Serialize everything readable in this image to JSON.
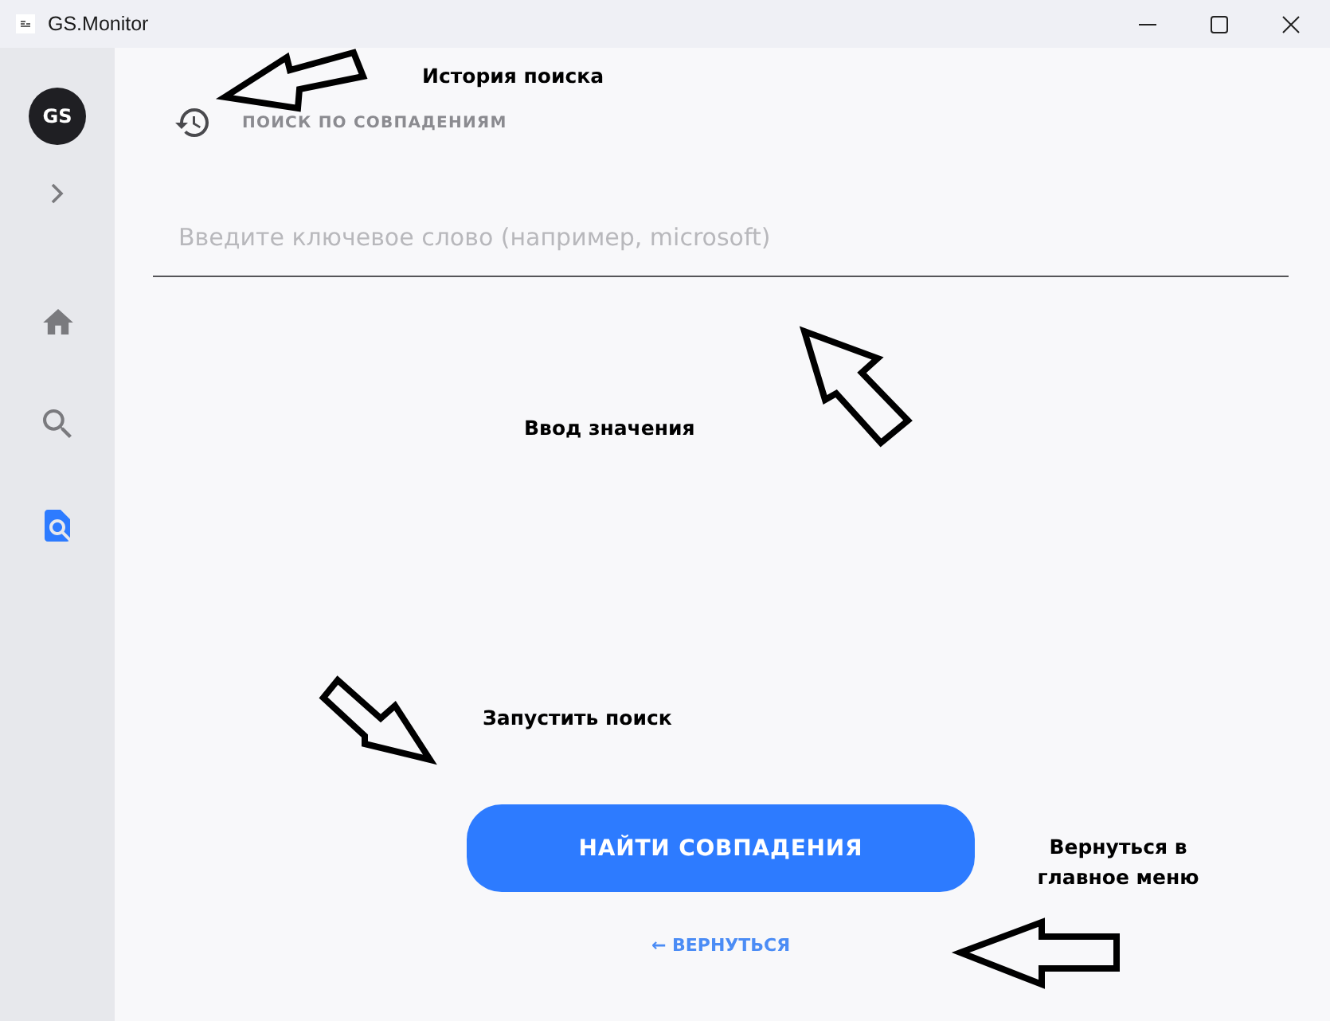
{
  "window": {
    "title": "GS.Monitor"
  },
  "sidebar": {
    "avatar": "GS",
    "expanded": false,
    "nav_items": [
      {
        "kind": "home",
        "selected": false
      },
      {
        "kind": "search",
        "selected": false
      },
      {
        "kind": "match",
        "selected": true
      }
    ]
  },
  "main": {
    "title": "ПОИСК ПО СОВПАДЕНИЯМ",
    "search": {
      "placeholder": "Введите ключевое слово (например, microsoft)"
    },
    "find_button": "НАЙТИ СОВПАДЕНИЯ",
    "back_link": "← ВЕРНУТЬСЯ"
  },
  "annotations": [
    "История поиска",
    "Ввод значения",
    "Запустить поиск",
    "Вернуться в главное меню"
  ]
}
